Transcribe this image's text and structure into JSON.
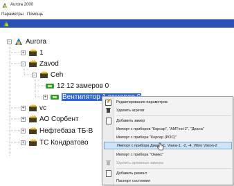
{
  "window": {
    "title": "Aurora 2000",
    "icon": "aurora-app-icon"
  },
  "menu": {
    "items": [
      "Параметры",
      "Помощь"
    ]
  },
  "toolbar": {
    "icon": "aurora-icon"
  },
  "tree": {
    "root": {
      "label": "Aurora",
      "expander": "−",
      "icon": "aurora-icon"
    },
    "items": [
      {
        "label": "1",
        "expander": "+",
        "icon": "factory-icon"
      },
      {
        "label": "Zavod",
        "expander": "−",
        "icon": "factory-icon"
      },
      {
        "label": "Ceh",
        "expander": "−",
        "icon": "factory-icon"
      },
      {
        "label": "12 12  замеров 0",
        "icon": "machine-icon"
      },
      {
        "label": "Вентилятор 1  замеров  0",
        "expander": "+",
        "icon": "machine-icon",
        "selected": true
      },
      {
        "label": "vc",
        "expander": "+",
        "icon": "factory-icon"
      },
      {
        "label": "АО Сорбент",
        "expander": "+",
        "icon": "factory-icon"
      },
      {
        "label": "Нефтебаза ТБ-В",
        "expander": "+",
        "icon": "factory-icon"
      },
      {
        "label": "ТС Кондратово",
        "expander": "+",
        "icon": "factory-icon"
      }
    ]
  },
  "context_menu": {
    "items": [
      {
        "label": "Редактирование параметров",
        "icon": "edit-icon",
        "enabled": true
      },
      {
        "label": "Удалить агрегат",
        "icon": "trash-icon",
        "enabled": true
      },
      {
        "label": "Добавить замер",
        "icon": "document-icon",
        "enabled": true
      },
      {
        "label": "Импорт с приборов \"Корсар\", \"АМТest-2\", \"Диана\"",
        "icon": "",
        "enabled": true
      },
      {
        "label": "Импорт с прибора \"Корсар (РОС)\"",
        "icon": "",
        "enabled": true
      },
      {
        "label": "Импорт с прибора Диана-С, Viana-1, -2, -4, Vibro Vision-2",
        "icon": "",
        "enabled": true,
        "highlighted": true
      },
      {
        "label": "Импорт с прибора \"Омикс\"",
        "icon": "",
        "enabled": true
      },
      {
        "label": "Удалить архивные замеры",
        "icon": "trash-icon",
        "enabled": false
      },
      {
        "label": "Добавить ремонт",
        "icon": "document-icon",
        "enabled": true
      },
      {
        "label": "Паспорт состояния",
        "icon": "",
        "enabled": true
      }
    ]
  }
}
